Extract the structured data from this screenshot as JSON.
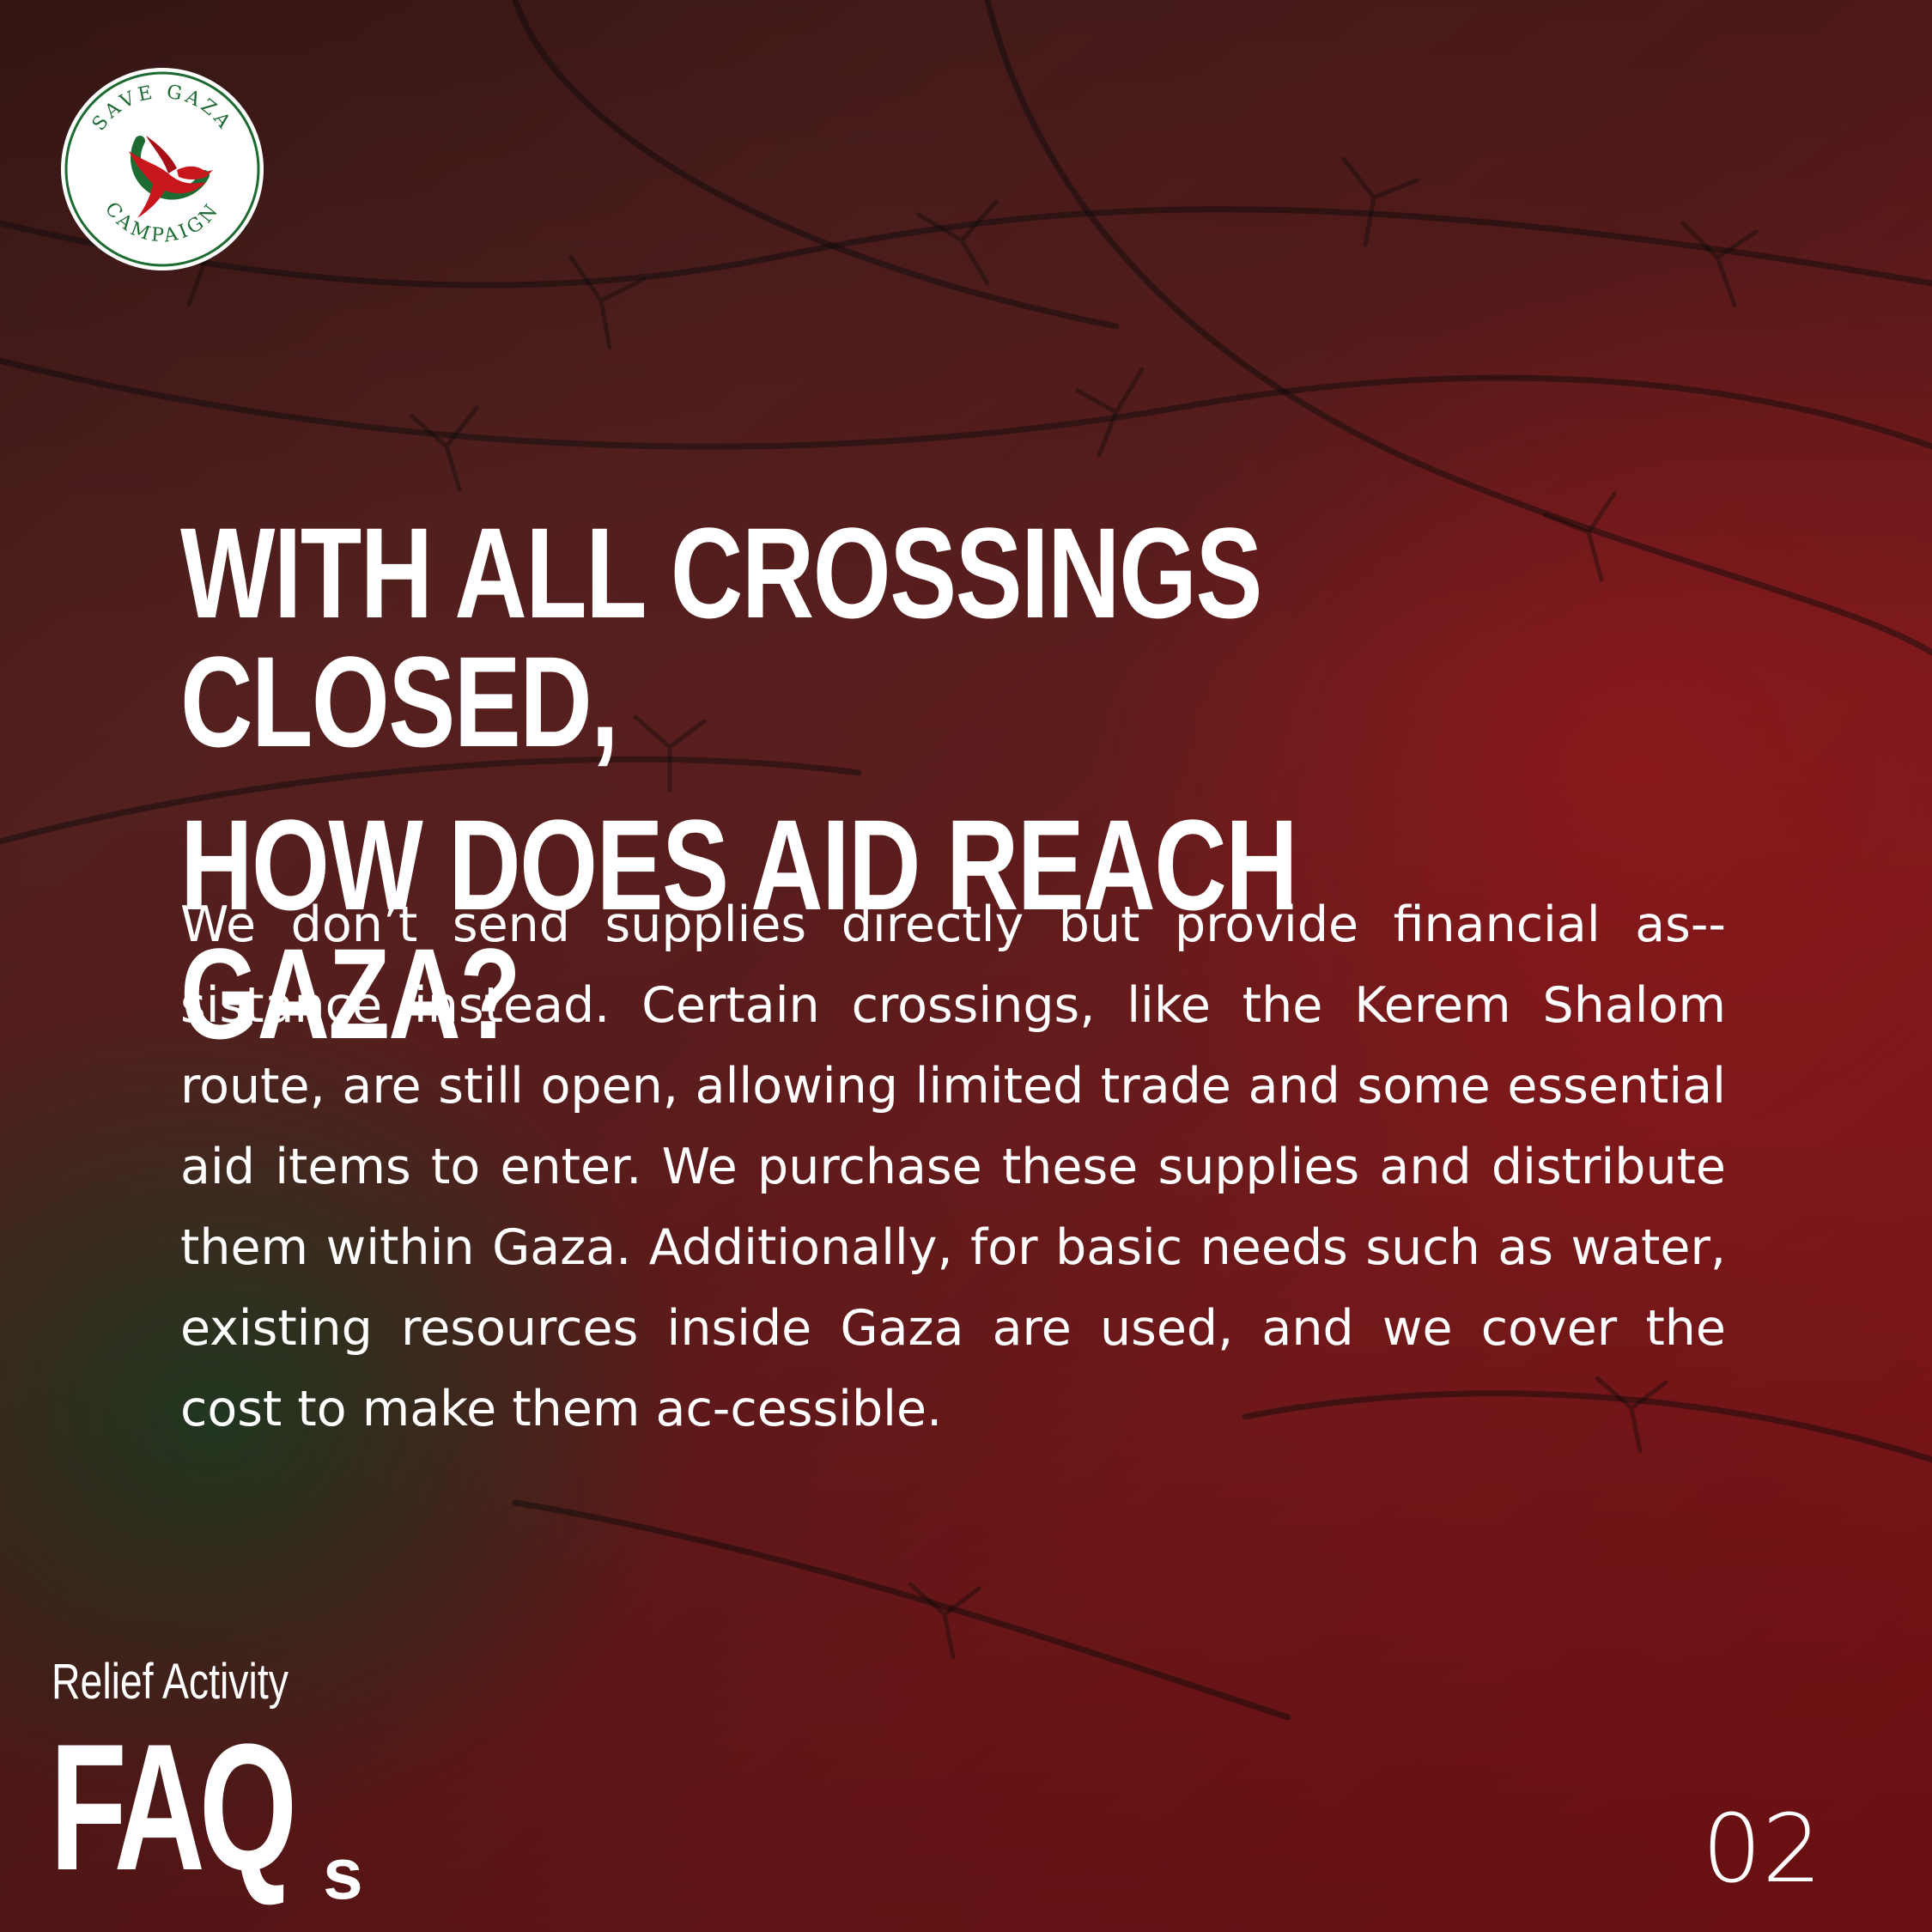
{
  "logo": {
    "top_text": "SAVE GAZA",
    "bottom_text": "CAMPAIGN",
    "icon": "dove-icon",
    "ring_color": "#1d6b33",
    "bird_color": "#c8161d"
  },
  "heading": {
    "line1": "WITH ALL CROSSINGS CLOSED,",
    "line2": "HOW DOES AID REACH GAZA?"
  },
  "body": "We don’t send supplies directly but provide financial as-­sistance instead. Certain crossings, like the Kerem Shalom route, are still open, allowing limited trade and some essential aid items to enter. We purchase these supplies and distribute them within Gaza. Additionally, for basic needs such as water, existing resources inside Gaza are used, and we cover the cost to make them ac-­cessible.",
  "faq": {
    "subtitle": "Relief Activity",
    "main": "FAQ",
    "suffix": "s"
  },
  "page_number": "02",
  "colors": {
    "red": "#8c1418",
    "green": "#124826",
    "text": "#ffffff"
  }
}
